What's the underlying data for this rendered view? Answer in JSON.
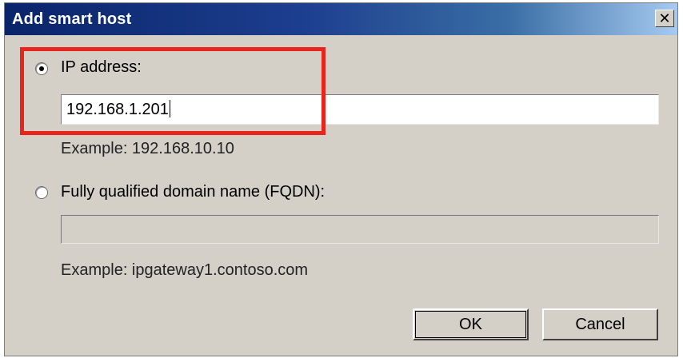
{
  "dialog": {
    "title": "Add smart host",
    "close_glyph": "✕"
  },
  "ip_option": {
    "label": "IP address:",
    "selected": true,
    "value": "192.168.1.201",
    "example": "Example: 192.168.10.10"
  },
  "fqdn_option": {
    "label": "Fully qualified domain name (FQDN):",
    "selected": false,
    "value": "",
    "example": "Example: ipgateway1.contoso.com"
  },
  "buttons": {
    "ok_label": "OK",
    "cancel_label": "Cancel"
  },
  "annotation": {
    "highlight_color": "#e8251c"
  }
}
